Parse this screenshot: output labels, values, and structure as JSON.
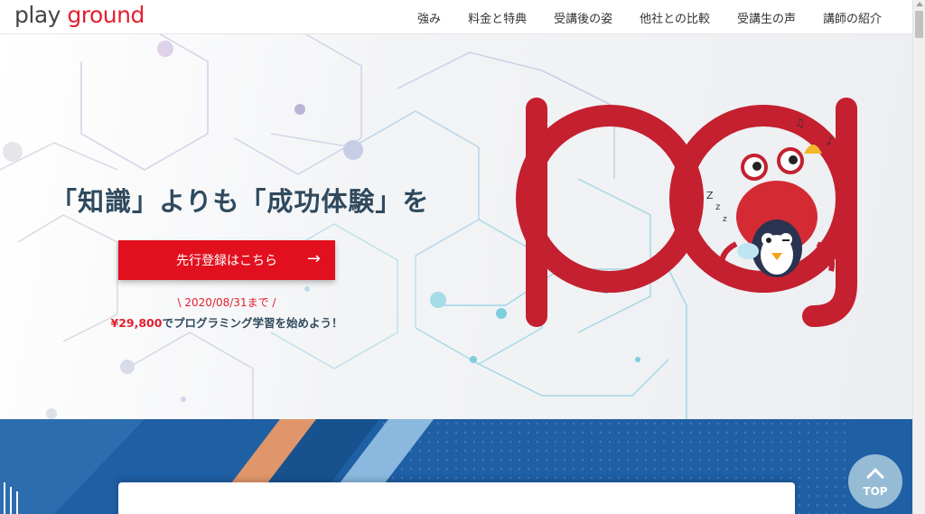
{
  "header": {
    "logo_part1": "play ",
    "logo_part2": "ground",
    "nav": [
      "強み",
      "料金と特典",
      "受講後の姿",
      "他社との比較",
      "受講生の声",
      "講師の紹介"
    ]
  },
  "hero": {
    "headline": "「知識」よりも「成功体験」を",
    "cta_label": "先行登録はこちら",
    "cta_arrow": "→",
    "deadline": "\\ 2020/08/31まで /",
    "price": "¥29,800",
    "price_suffix": "でプログラミング学習を始めよう！"
  },
  "top_button": {
    "label": "TOP"
  },
  "colors": {
    "brand_red": "#e2202f",
    "navy": "#2f4a5e",
    "band_blue": "#1e5fa3"
  }
}
